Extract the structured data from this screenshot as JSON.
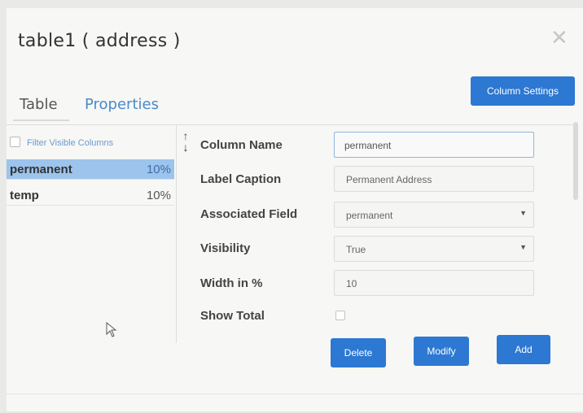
{
  "dialog": {
    "title": "table1 ( address )",
    "close_label": "✕"
  },
  "tabs": [
    {
      "label": "Table",
      "active": true
    },
    {
      "label": "Properties",
      "active": false
    }
  ],
  "column_settings_label": "Column Settings",
  "left_panel": {
    "filter_label": "Filter Visible Columns",
    "columns": [
      {
        "name": "permanent",
        "width": "10%",
        "selected": true
      },
      {
        "name": "temp",
        "width": "10%",
        "selected": false
      }
    ]
  },
  "sort_arrows": {
    "up": "↑",
    "down": "↓"
  },
  "form": {
    "column_name": {
      "label": "Column Name",
      "value": "permanent"
    },
    "label_caption": {
      "label": "Label Caption",
      "value": "Permanent Address"
    },
    "associated_field": {
      "label": "Associated Field",
      "value": "permanent"
    },
    "visibility": {
      "label": "Visibility",
      "value": "True"
    },
    "width": {
      "label": "Width in %",
      "value": "10"
    },
    "show_total": {
      "label": "Show Total",
      "checked": false
    }
  },
  "buttons": {
    "delete": "Delete",
    "modify": "Modify",
    "add": "Add"
  },
  "colors": {
    "accent": "#2c78d2",
    "selected_row": "#9cc4ec",
    "tab_link": "#4a8ac9"
  }
}
